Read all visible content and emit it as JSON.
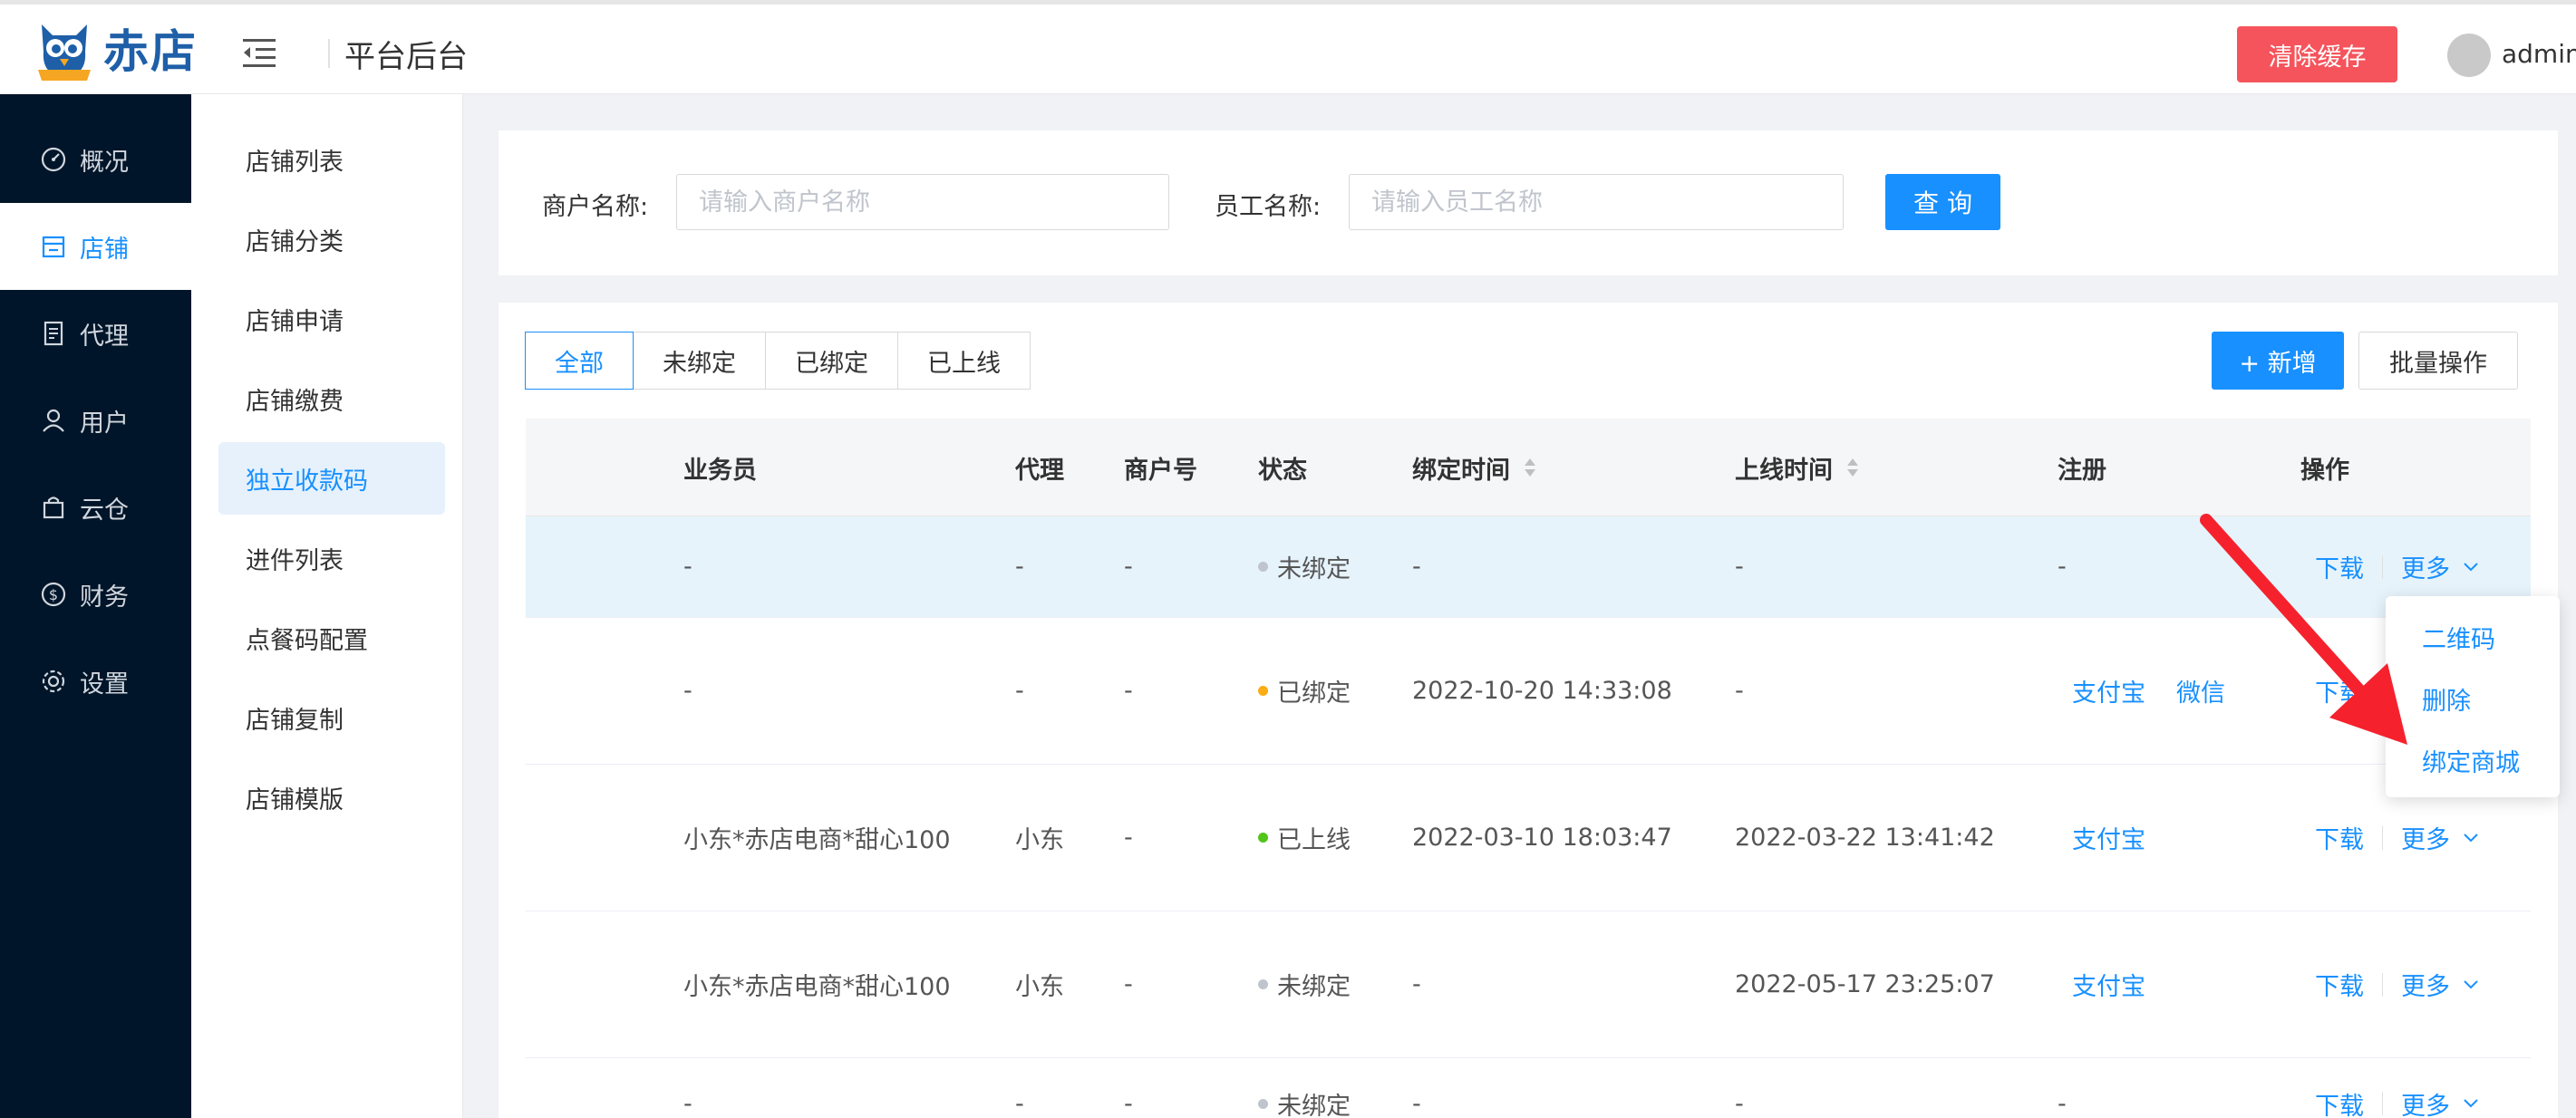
{
  "header": {
    "brand": "赤店",
    "title": "平台后台",
    "clear_cache_label": "清除缓存",
    "username": "admin"
  },
  "sidebar": {
    "items": [
      {
        "label": "概况",
        "icon": "dashboard-icon"
      },
      {
        "label": "店铺",
        "icon": "store-icon"
      },
      {
        "label": "代理",
        "icon": "document-icon"
      },
      {
        "label": "用户",
        "icon": "user-icon"
      },
      {
        "label": "云仓",
        "icon": "bag-icon"
      },
      {
        "label": "财务",
        "icon": "dollar-icon"
      },
      {
        "label": "设置",
        "icon": "gear-icon"
      }
    ]
  },
  "subnav": {
    "items": [
      "店铺列表",
      "店铺分类",
      "店铺申请",
      "店铺缴费",
      "独立收款码",
      "进件列表",
      "点餐码配置",
      "店铺复制",
      "店铺模版"
    ]
  },
  "search": {
    "merchant_label": "商户名称:",
    "merchant_placeholder": "请输入商户名称",
    "staff_label": "员工名称:",
    "staff_placeholder": "请输入员工名称",
    "query_label": "查 询"
  },
  "tabs": [
    "全部",
    "未绑定",
    "已绑定",
    "已上线"
  ],
  "actions": {
    "add_label": "+ 新增",
    "batch_label": "批量操作"
  },
  "table": {
    "headers": [
      "业务员",
      "代理",
      "商户号",
      "状态",
      "绑定时间",
      "上线时间",
      "注册",
      "操作"
    ],
    "rows": [
      {
        "salesman": "-",
        "agent": "-",
        "merchant_no": "-",
        "status": "未绑定",
        "bind_time": "-",
        "online_time": "-",
        "register": "-",
        "reg_links": [],
        "download": "下载",
        "more": "更多"
      },
      {
        "salesman": "-",
        "agent": "-",
        "merchant_no": "-",
        "status": "已绑定",
        "bind_time": "2022-10-20 14:33:08",
        "online_time": "-",
        "register": "",
        "reg_links": [
          "支付宝",
          "微信"
        ],
        "download": "下载",
        "more": ""
      },
      {
        "salesman": "小东*赤店电商*甜心100",
        "agent": "小东",
        "merchant_no": "-",
        "status": "已上线",
        "bind_time": "2022-03-10 18:03:47",
        "online_time": "2022-03-22 13:41:42",
        "register": "",
        "reg_links": [
          "支付宝"
        ],
        "download": "下载",
        "more": "更多"
      },
      {
        "salesman": "小东*赤店电商*甜心100",
        "agent": "小东",
        "merchant_no": "-",
        "status": "未绑定",
        "bind_time": "-",
        "online_time": "2022-05-17 23:25:07",
        "register": "",
        "reg_links": [
          "支付宝"
        ],
        "download": "下载",
        "more": "更多"
      },
      {
        "salesman": "-",
        "agent": "-",
        "merchant_no": "-",
        "status": "未绑定",
        "bind_time": "-",
        "online_time": "-",
        "register": "-",
        "reg_links": [],
        "download": "下载",
        "more": "更多"
      }
    ]
  },
  "dropdown": {
    "items": [
      "二维码",
      "删除",
      "绑定商城"
    ]
  },
  "colors": {
    "primary": "#1890ff",
    "danger": "#f5545c",
    "sidebar_bg": "#001529",
    "status_unbound": "#c0c4cc",
    "status_bound": "#faad14",
    "status_online": "#52c41a",
    "annotation_arrow": "#f5222d"
  }
}
